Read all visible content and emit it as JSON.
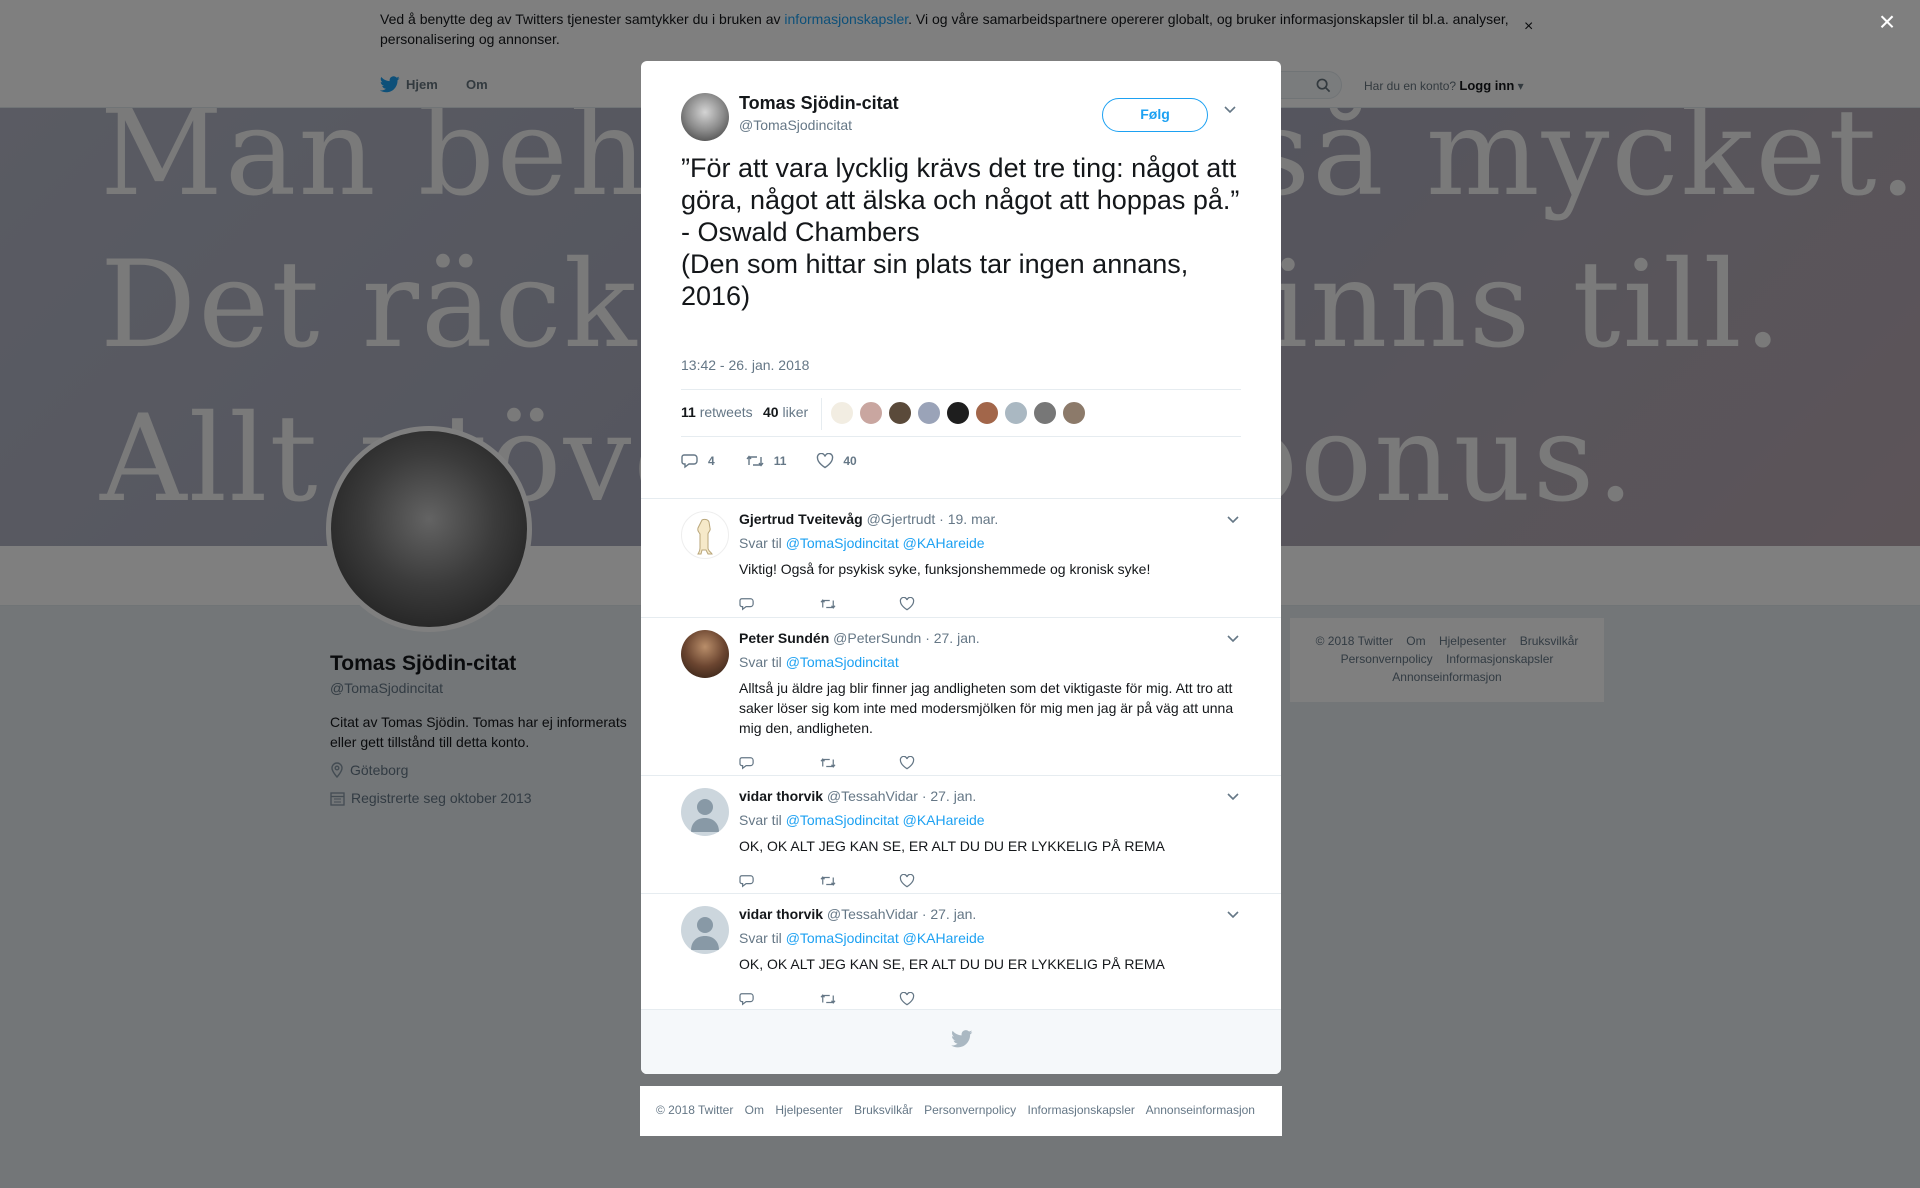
{
  "cookie_bar": {
    "text_before": "Ved å benytte deg av Twitters tjenester samtykker du i bruken av ",
    "link": "informasjonskapsler",
    "text_after": ". Vi og våre samarbeidspartnere opererer globalt, og bruker informasjonskapsler til bl.a. analyser, personalisering og annonser.",
    "close": "×"
  },
  "nav": {
    "home": "Hjem",
    "about": "Om",
    "login_prompt": "Har du en konto?",
    "login": "Logg inn"
  },
  "banner": {
    "line1": "Man behöver inte så mycket. Det räcka till.",
    "line2": "Det räcker att du finns till.",
    "line3": "Allt utöver det är bonus."
  },
  "profile": {
    "name": "Tomas Sjödin-citat",
    "handle": "@TomaSjodincitat",
    "bio": "Citat av Tomas Sjödin. Tomas har ej informerats eller gett tillstånd till detta konto.",
    "location": "Göteborg",
    "joined": "Registrerte seg oktober 2013"
  },
  "side_footer": [
    "© 2018 Twitter",
    "Om",
    "Hjelpesenter",
    "Bruksvilkår",
    "Personvernpolicy",
    "Informasjonskapsler",
    "Annonseinformasjon"
  ],
  "modal": {
    "close": "×",
    "author_name": "Tomas Sjödin-citat",
    "author_handle": "@TomaSjodincitat",
    "follow": "Følg",
    "text": "”För att vara lycklig krävs det tre ting: något att göra, något att älska och något att hoppas på.”\n- Oswald Chambers\n(Den som hittar sin plats tar ingen annans, 2016)",
    "timestamp": "13:42 - 26. jan. 2018",
    "retweets_count": "11",
    "retweets_label": "retweets",
    "likes_count": "40",
    "likes_label": "liker",
    "reply_count": "4",
    "retweet_count": "11",
    "like_count": "40"
  },
  "replies": [
    {
      "name": "Gjertrud Tveitevåg",
      "handle": "@Gjertrudt",
      "date": "· 19. mar.",
      "reply_label": "Svar til",
      "mentions": "@TomaSjodincitat @KAHareide",
      "text": "Viktig! Også for psykisk  syke, funksjonshemmede og kronisk syke!"
    },
    {
      "name": "Peter Sundén",
      "handle": "@PeterSundn",
      "date": "· 27. jan.",
      "reply_label": "Svar til",
      "mentions": "@TomaSjodincitat",
      "text": "Alltså ju äldre jag blir finner jag andligheten som det viktigaste för mig. Att tro att saker löser sig kom inte med modersmjölken för mig men jag är på väg att unna mig den, andligheten."
    },
    {
      "name": "vidar thorvik",
      "handle": "@TessahVidar",
      "date": "· 27. jan.",
      "reply_label": "Svar til",
      "mentions": "@TomaSjodincitat @KAHareide",
      "text": "OK, OK ALT JEG KAN SE, ER ALT DU DU ER LYKKELIG PÅ REMA"
    },
    {
      "name": "vidar thorvik",
      "handle": "@TessahVidar",
      "date": "· 27. jan.",
      "reply_label": "Svar til",
      "mentions": "@TomaSjodincitat @KAHareide",
      "text": "OK, OK ALT JEG KAN SE, ER ALT DU DU ER LYKKELIG PÅ REMA"
    }
  ],
  "below_footer": [
    "© 2018 Twitter",
    "Om",
    "Hjelpesenter",
    "Bruksvilkår",
    "Personvernpolicy",
    "Informasjonskapsler",
    "Annonseinformasjon"
  ],
  "colors": {
    "accent": "#1da1f2",
    "text": "#14171a",
    "muted": "#657786",
    "overlay": "rgba(0,0,0,0.5)"
  },
  "icons": [
    "twitter-bird-icon",
    "search-icon",
    "location-icon",
    "calendar-icon",
    "reply-icon",
    "retweet-icon",
    "like-icon",
    "chevron-down-icon",
    "close-icon"
  ]
}
